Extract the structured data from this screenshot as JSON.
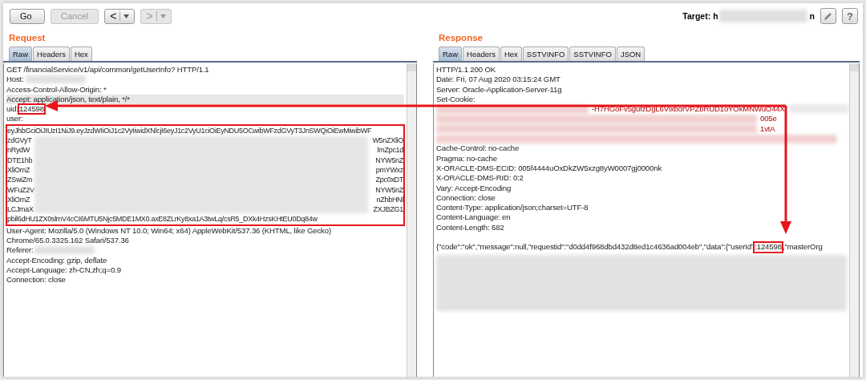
{
  "toolbar": {
    "buttons": [
      {
        "label": "Go",
        "disabled": false
      },
      {
        "label": "Cancel",
        "disabled": true
      }
    ],
    "nav": [
      {
        "glyph": "<",
        "disabled": false
      },
      {
        "glyph": ">",
        "disabled": true
      }
    ],
    "target": {
      "label": "Target:",
      "value_start": "h",
      "value_end": "n"
    },
    "help": "?"
  },
  "request": {
    "title": "Request",
    "tabs": [
      {
        "label": "Raw",
        "selected": true
      },
      {
        "label": "Headers",
        "selected": false
      },
      {
        "label": "Hex",
        "selected": false
      }
    ],
    "lines": [
      {
        "kind": "text",
        "text": "GET /financialService/v1/api/common/getUserInfo? HTTP/1.1",
        "current": false
      },
      {
        "kind": "redacted",
        "text": "Host:",
        "current": false
      },
      {
        "kind": "text",
        "text": "Access-Control-Allow-Origin: *",
        "current": false
      },
      {
        "kind": "text",
        "text": "Accept: application/json, text/plain, */*",
        "current": true
      },
      {
        "kind": "boxed",
        "text": "uid:",
        "value": "124598",
        "current": false
      },
      {
        "kind": "text",
        "text": "user:",
        "current": false
      },
      {
        "kind": "token",
        "first": "eyJhbGciOiJIUzI1NiJ9.eyJzdWIiOiJ1c2VyIiwidXNlcjI6eyJ1c2VyU1ciOiEyNDU5OCwibWFzdGVyT3JnSWQiOiEwMiwibWF",
        "rows": [
          {
            "left": "zdGVyT",
            "right": "W5nZXliO"
          },
          {
            "left": "nRydW",
            "right": "lmZpc1d"
          },
          {
            "left": "DTE1hb",
            "right": "NYW5nZ"
          },
          {
            "left": "XliOmZ",
            "right": "pmYWxz"
          },
          {
            "left": "ZSwiZm",
            "right": "Zpc0xDT"
          },
          {
            "left": "WFuZ2V",
            "right": "NYW5nZ"
          },
          {
            "left": "XliOmZ",
            "right": "nZhbHNl"
          },
          {
            "left": "LCJmaX",
            "right": "ZXJBZG1"
          }
        ],
        "last": "pbil6dHU1ZX0slmV4cCI6MTU5Njc5MDE1MX0.axE8ZLrKy8xa1A3twLq/csR5_DXk4HzsKHtEU0Dq84w",
        "current": false
      },
      {
        "kind": "text",
        "text": "User-Agent: Mozilla/5.0 (Windows NT 10.0; Win64; x64) AppleWebKit/537.36 (KHTML, like Gecko)",
        "current": false
      },
      {
        "kind": "text",
        "text": "Chrome/65.0.3325.162 Safari/537.36",
        "current": false
      },
      {
        "kind": "redacted",
        "text": "Referer:",
        "current": false
      },
      {
        "kind": "text",
        "text": "Accept-Encoding: gzip, deflate",
        "current": false
      },
      {
        "kind": "text",
        "text": "Accept-Language: zh-CN,zh;q=0.9",
        "current": false
      },
      {
        "kind": "text",
        "text": "Connection: close",
        "current": false
      }
    ]
  },
  "response": {
    "title": "Response",
    "tabs": [
      {
        "label": "Raw",
        "selected": true
      },
      {
        "label": "Headers",
        "selected": false
      },
      {
        "label": "Hex",
        "selected": false
      },
      {
        "label": "SSTVINFO",
        "selected": false
      },
      {
        "label": "SSTVINFO",
        "selected": false
      },
      {
        "label": "JSON",
        "selected": false
      }
    ],
    "lines": [
      {
        "kind": "text",
        "text": "HTTP/1.1 200 OK"
      },
      {
        "kind": "text",
        "text": "Date: Fri, 07 Aug 2020 03:15:24 GMT"
      },
      {
        "kind": "text",
        "text": "Server: Oracle-Application-Server-11g"
      },
      {
        "kind": "text",
        "text": "Set-Cookie:"
      },
      {
        "kind": "cookie",
        "fragments": [
          "-H7HGoFv5gufzDgL6VlxborVPZbRUD1oYOkMNWuO44X",
          "005e",
          "1vtA"
        ]
      },
      {
        "kind": "text",
        "text": "Cache-Control: no-cache"
      },
      {
        "kind": "text",
        "text": "Pragma: no-cache"
      },
      {
        "kind": "text",
        "text": "X-ORACLE-DMS-ECID: 005f4444uOxDkZW5xzg8yW0007gj0000nk"
      },
      {
        "kind": "text",
        "text": "X-ORACLE-DMS-RID: 0:2"
      },
      {
        "kind": "text",
        "text": "Vary: Accept-Encoding"
      },
      {
        "kind": "text",
        "text": "Connection: close"
      },
      {
        "kind": "text",
        "text": "Content-Type: application/json;charset=UTF-8"
      },
      {
        "kind": "text",
        "text": "Content-Language: en"
      },
      {
        "kind": "text",
        "text": "Content-Length: 682"
      },
      {
        "kind": "blank"
      },
      {
        "kind": "boxed",
        "text": "{\"code\":\"ok\",\"message\":null,\"requestid\":\"d0dd4f968dbd432d8ed1c4636ad004eb\",\"data\":{\"userId\"",
        "value": ":124598",
        "after": ",\"masterOrg"
      },
      {
        "kind": "redacted-block"
      }
    ]
  }
}
